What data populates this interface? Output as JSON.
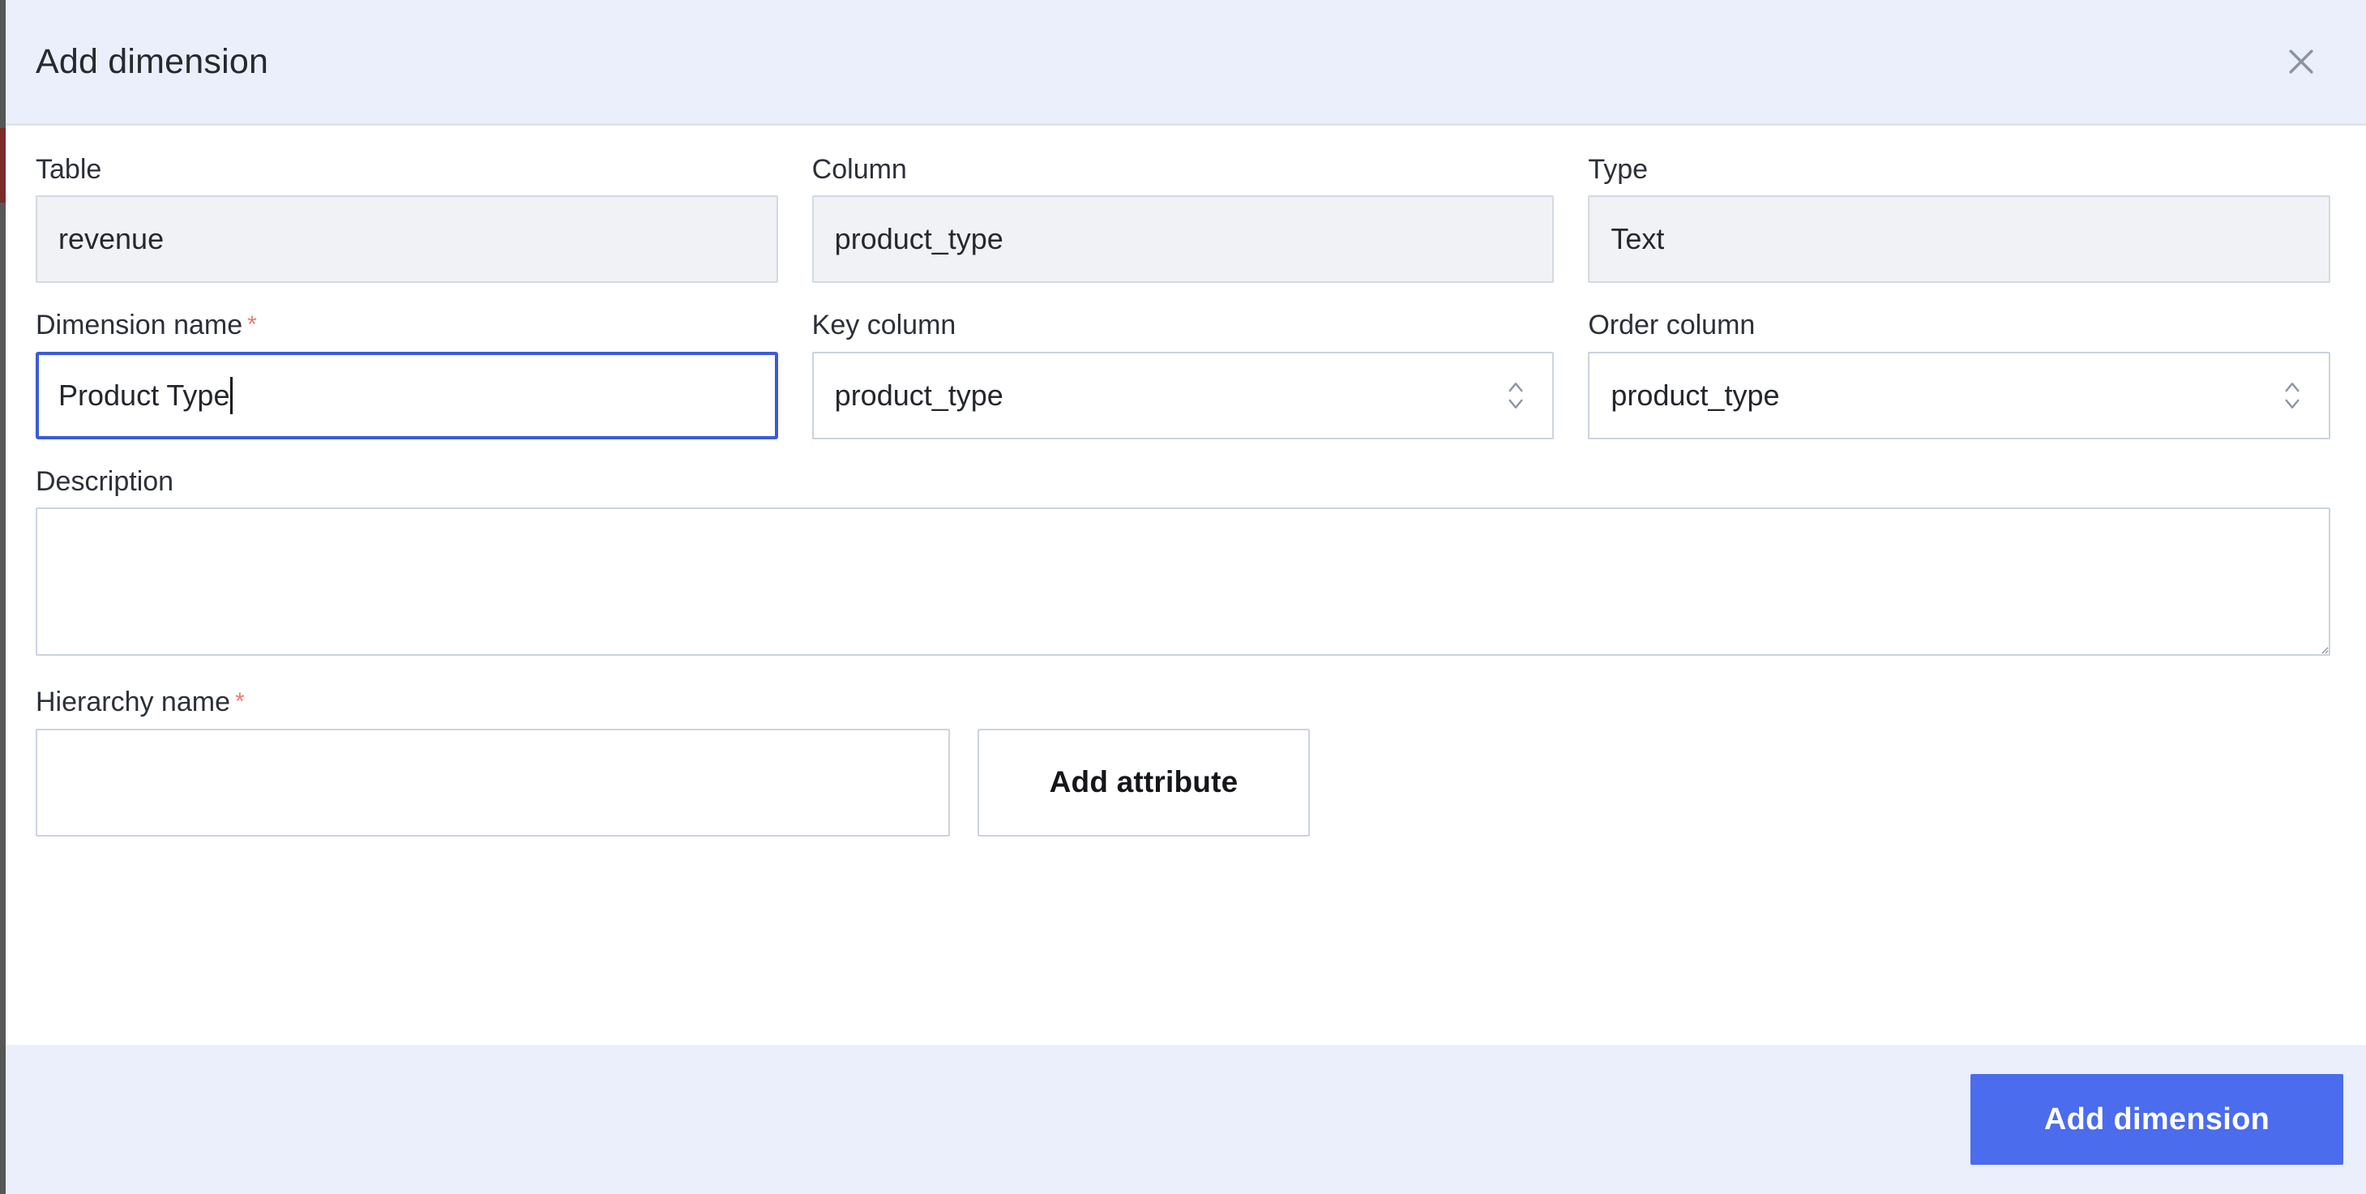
{
  "dialog": {
    "title": "Add dimension",
    "close_icon": "close-icon",
    "accent_color": "#4a6ced",
    "header_bg": "#eaeffb",
    "required_marker": "*"
  },
  "form": {
    "table": {
      "label": "Table",
      "value": "revenue",
      "readonly": true
    },
    "column": {
      "label": "Column",
      "value": "product_type",
      "readonly": true
    },
    "type": {
      "label": "Type",
      "value": "Text",
      "readonly": true
    },
    "dimension_name": {
      "label": "Dimension name",
      "value": "Product Type",
      "placeholder": "",
      "required": true,
      "focused": true
    },
    "key_column": {
      "label": "Key column",
      "value": "product_type",
      "stepper_icon": "chevron-up-down-icon"
    },
    "order_column": {
      "label": "Order column",
      "value": "product_type",
      "stepper_icon": "chevron-up-down-icon"
    },
    "description": {
      "label": "Description",
      "value": "",
      "placeholder": ""
    },
    "hierarchy_name": {
      "label": "Hierarchy name",
      "value": "",
      "placeholder": "",
      "required": true
    },
    "add_attribute_label": "Add attribute"
  },
  "footer": {
    "submit_label": "Add dimension"
  }
}
